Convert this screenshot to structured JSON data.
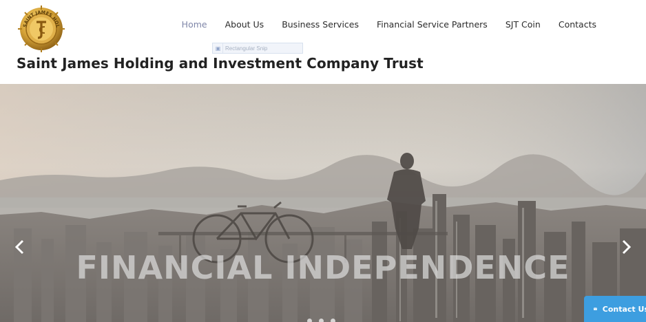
{
  "site": {
    "title": "Saint James Holding and Investment Company Trust",
    "logo_text": "SAINT JAMES HOLDING"
  },
  "nav": {
    "items": [
      {
        "label": "Home",
        "active": true
      },
      {
        "label": "About Us",
        "active": false
      },
      {
        "label": "Business Services",
        "active": false
      },
      {
        "label": "Financial Service Partners",
        "active": false
      },
      {
        "label": "SJT Coin",
        "active": false
      },
      {
        "label": "Contacts",
        "active": false
      }
    ]
  },
  "overlay": {
    "snip_label": "Rectangular Snip"
  },
  "hero": {
    "caption": "FINANCIAL INDEPENDENCE",
    "slide_count": 3,
    "active_slide": 2
  },
  "contact_tab": {
    "label": "Contact Us"
  },
  "colors": {
    "nav_active": "#7f86a8",
    "contact_tab": "#3d9ee0",
    "logo_gold": "#c9962a"
  },
  "icons": [
    "logo-seal-icon",
    "chevron-left-icon",
    "chevron-right-icon",
    "envelope-icon",
    "snip-icon"
  ]
}
